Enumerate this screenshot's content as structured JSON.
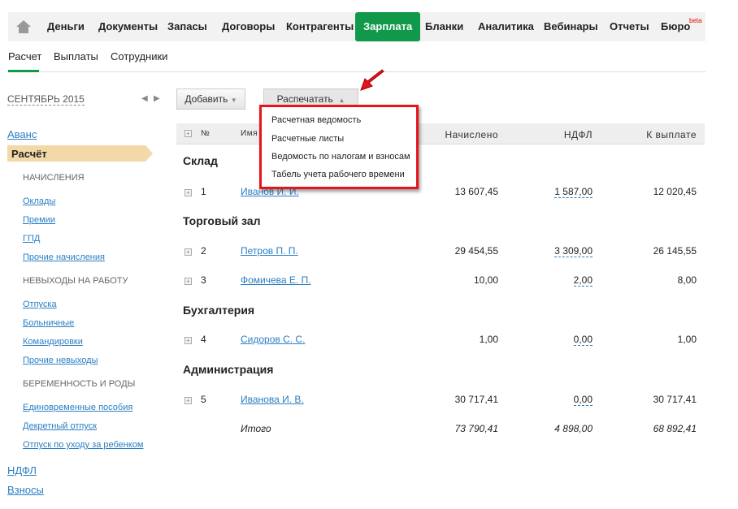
{
  "nav": {
    "items": [
      "Деньги",
      "Документы",
      "Запасы",
      "Договоры",
      "Контрагенты",
      "Зарплата",
      "Бланки",
      "Аналитика",
      "Вебинары",
      "Отчеты",
      "Бюро"
    ],
    "badge": "beta",
    "active": "Зарплата"
  },
  "subnav": [
    "Расчет",
    "Выплаты",
    "Сотрудники"
  ],
  "period": "СЕНТЯБРЬ 2015",
  "sidebar": {
    "avans": "Аванс",
    "raschet": "Расчёт",
    "cap1": "НАЧИСЛЕНИЯ",
    "l1": [
      "Оклады",
      "Премии",
      "ГПД",
      "Прочие начисления"
    ],
    "cap2": "НЕВЫХОДЫ НА РАБОТУ",
    "l2": [
      "Отпуска",
      "Больничные",
      "Командировки",
      "Прочие невыходы"
    ],
    "cap3": "БЕРЕМЕННОСТЬ И РОДЫ",
    "l3": [
      "Единовременные пособия",
      "Декретный отпуск",
      "Отпуск по уходу за ребенком"
    ],
    "ndfl": "НДФЛ",
    "vznosy": "Взносы"
  },
  "toolbar": {
    "add": "Добавить",
    "print": "Распечатать"
  },
  "dropdown": [
    "Расчетная ведомость",
    "Расчетные листы",
    "Ведомость по налогам и взносам",
    "Табель учета рабочего времени"
  ],
  "table": {
    "headers": [
      "№",
      "Имя",
      "Начислено",
      "НДФЛ",
      "К выплате"
    ],
    "groups": [
      "Склад",
      "Торговый зал",
      "Бухгалтерия",
      "Администрация"
    ],
    "rows": [
      [
        "1",
        "Иванов И. И.",
        "13 607,45",
        "1 587,00",
        "12 020,45"
      ],
      [
        "2",
        "Петров П. П.",
        "29 454,55",
        "3 309,00",
        "26 145,55"
      ],
      [
        "3",
        "Фомичева Е. П.",
        "10,00",
        "2,00",
        "8,00"
      ],
      [
        "4",
        "Сидоров С. С.",
        "1,00",
        "0,00",
        "1,00"
      ],
      [
        "5",
        "Иванова И. В.",
        "30 717,41",
        "0,00",
        "30 717,41"
      ]
    ],
    "total": [
      "Итого",
      "73 790,41",
      "4 898,00",
      "68 892,41"
    ]
  }
}
